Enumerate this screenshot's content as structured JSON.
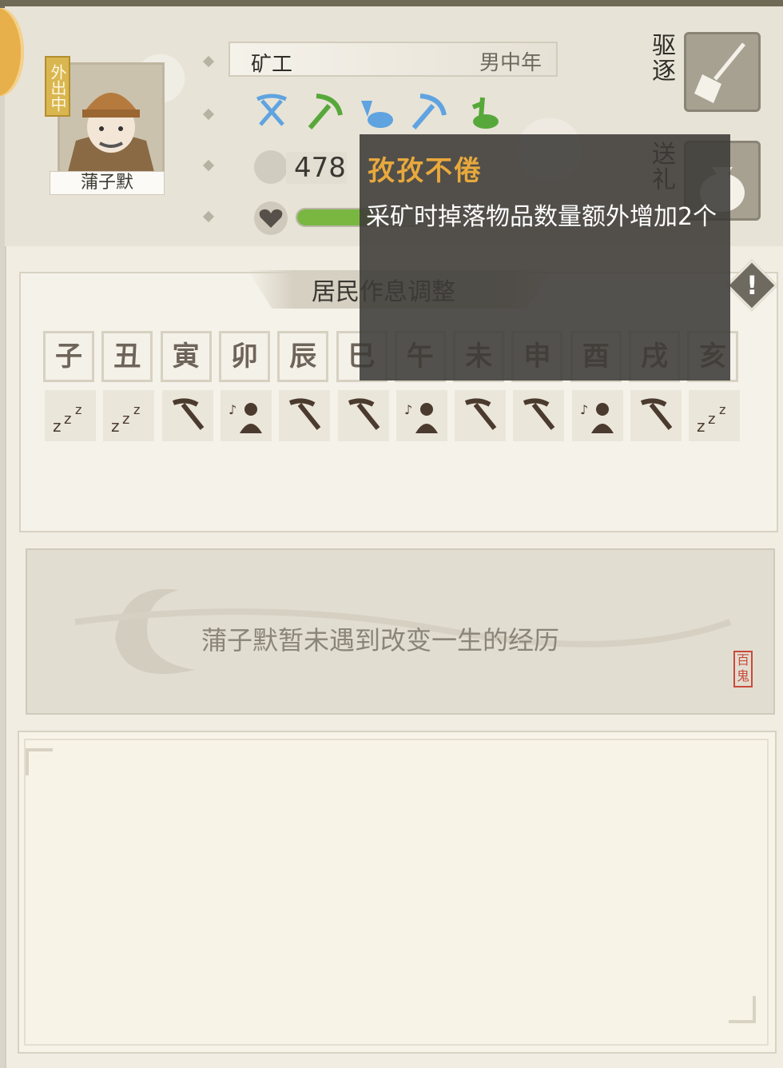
{
  "resident": {
    "name": "蒲子默",
    "status_tag": "外出中",
    "job": "矿工",
    "attributes": "男中年",
    "stat_value": "478",
    "health_fraction": 0.6
  },
  "actions": {
    "expel_label": "驱逐",
    "gift_label": "送礼"
  },
  "skills": [
    {
      "icon": "crossed-pickaxes-icon",
      "color": "#5fa3e0"
    },
    {
      "icon": "pickaxe-icon",
      "color": "#57a83b"
    },
    {
      "icon": "ore-pile-icon",
      "color": "#5fa3e0"
    },
    {
      "icon": "pickaxe-icon",
      "color": "#5fa3e0"
    },
    {
      "icon": "shovel-dirt-icon",
      "color": "#57a83b"
    }
  ],
  "schedule": {
    "title": "居民作息调整",
    "hours": [
      "子",
      "丑",
      "寅",
      "卯",
      "辰",
      "巳",
      "午",
      "未",
      "申",
      "酉",
      "戌",
      "亥"
    ],
    "activities": [
      "sleep-icon",
      "sleep-icon",
      "pickaxe-icon",
      "leisure-icon",
      "pickaxe-icon",
      "pickaxe-icon",
      "leisure-icon",
      "pickaxe-icon",
      "pickaxe-icon",
      "leisure-icon",
      "pickaxe-icon",
      "sleep-icon"
    ]
  },
  "experience": {
    "text": "蒲子默暂未遇到改变一生的经历",
    "seal_text": "百鬼"
  },
  "tooltip": {
    "title": "孜孜不倦",
    "description": "采矿时掉落物品数量额外增加2个"
  },
  "colors": {
    "panel_bg": "#f1ede3",
    "tooltip_bg": "#3c3a37",
    "tooltip_title": "#e8a93c",
    "health_green": "#79b741",
    "status_tag_gold": "#d9b64f"
  }
}
